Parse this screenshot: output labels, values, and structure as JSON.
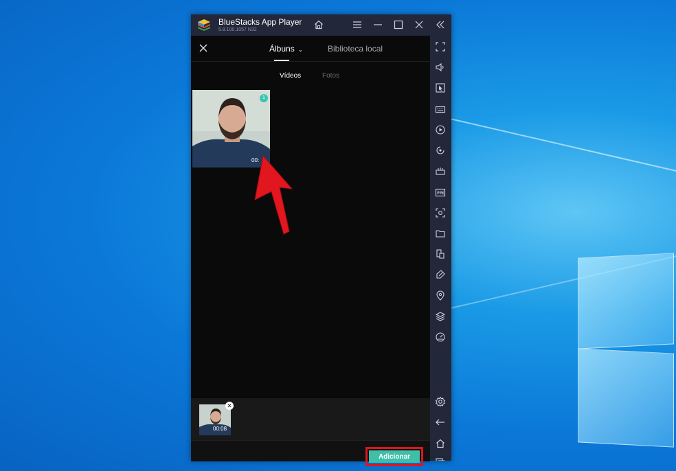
{
  "window": {
    "title": "BlueStacks App Player",
    "version": "5.8.100.1057  N32"
  },
  "header": {
    "tab_albums": "Álbuns",
    "tab_local": "Biblioteca local"
  },
  "subtabs": {
    "videos": "Vídeos",
    "photos": "Fotos"
  },
  "gallery": {
    "items": [
      {
        "badge": "1",
        "duration": "00:"
      }
    ]
  },
  "selected": {
    "items": [
      {
        "duration": "00:08",
        "remove": "✕"
      }
    ]
  },
  "footer": {
    "add_label": "Adicionar"
  },
  "colors": {
    "accent": "#3fbfa8",
    "highlight": "#e0141c",
    "chrome": "#23273a"
  },
  "sidebar_icons": [
    "fullscreen-icon",
    "volume-icon",
    "cursor-icon",
    "keyboard-icon",
    "record-icon",
    "rotate-icon",
    "macro-icon",
    "apk-icon",
    "screenshot-icon",
    "folder-icon",
    "multi-instance-icon",
    "eco-mode-icon",
    "location-icon",
    "layers-icon",
    "performance-icon",
    "settings-icon",
    "back-icon",
    "home-icon",
    "recent-apps-icon"
  ]
}
